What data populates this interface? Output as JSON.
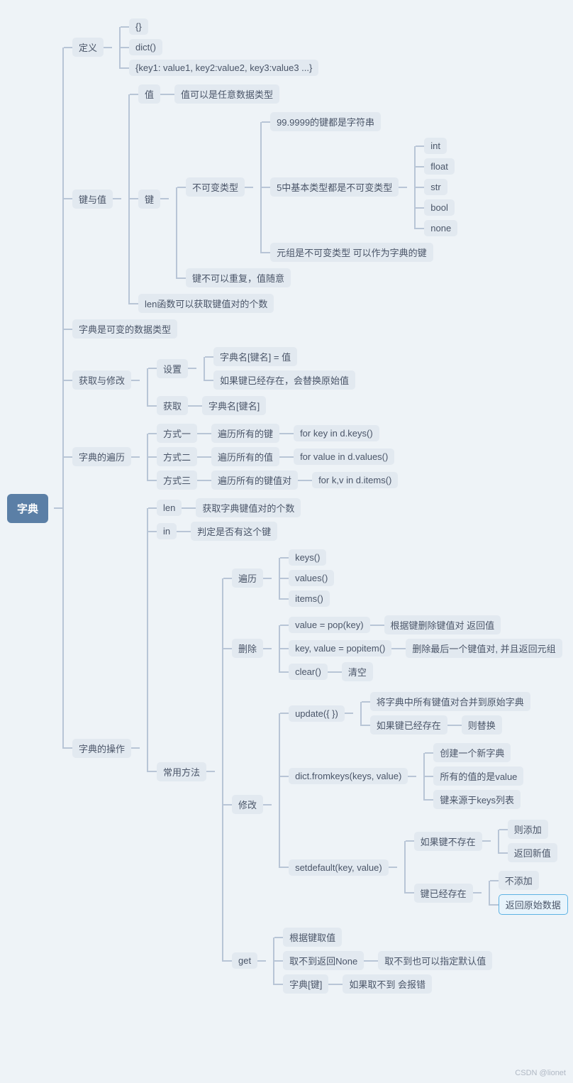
{
  "watermark": "CSDN @lionet",
  "root": "字典",
  "def": {
    "label": "定义",
    "c": [
      "{}",
      "dict()",
      "{key1: value1, key2:value2, key3:value3 ...}"
    ]
  },
  "kv": {
    "label": "键与值",
    "value": {
      "label": "值",
      "desc": "值可以是任意数据类型"
    },
    "key": {
      "label": "键",
      "immutable": {
        "label": "不可变类型",
        "most": "99.9999的键都是字符串",
        "basic": {
          "label": "5中基本类型都是不可变类型",
          "types": [
            "int",
            "float",
            "str",
            "bool",
            "none"
          ]
        },
        "tuple": "元组是不可变类型 可以作为字典的键"
      },
      "norepeat": "键不可以重复，值随意"
    },
    "len": "len函数可以获取键值对的个数"
  },
  "mutable": "字典是可变的数据类型",
  "getset": {
    "label": "获取与修改",
    "set": {
      "label": "设置",
      "c": [
        "字典名[键名] = 值",
        "如果键已经存在，会替换原始值"
      ]
    },
    "get": {
      "label": "获取",
      "c": "字典名[键名]"
    }
  },
  "iter": {
    "label": "字典的遍历",
    "ways": [
      {
        "w": "方式一",
        "d": "遍历所有的键",
        "code": "for key in d.keys()"
      },
      {
        "w": "方式二",
        "d": "遍历所有的值",
        "code": "for  value in d.values()"
      },
      {
        "w": "方式三",
        "d": "遍历所有的键值对",
        "code": "for k,v in d.items()"
      }
    ]
  },
  "ops": {
    "label": "字典的操作",
    "len": {
      "label": "len",
      "desc": "获取字典键值对的个数"
    },
    "in": {
      "label": "in",
      "desc": "判定是否有这个键"
    },
    "methods": {
      "label": "常用方法",
      "iter": {
        "label": "遍历",
        "c": [
          "keys()",
          "values()",
          "items()"
        ]
      },
      "del": {
        "label": "删除",
        "pop": {
          "label": "value = pop(key)",
          "desc": "根据键删除键值对 返回值"
        },
        "popitem": {
          "label": "key, value = popitem()",
          "desc": "删除最后一个键值对, 并且返回元组"
        },
        "clear": {
          "label": "clear()",
          "desc": "清空"
        }
      },
      "mod": {
        "label": "修改",
        "update": {
          "label": "update({ })",
          "c1": "将字典中所有键值对合并到原始字典",
          "c2": "如果键已经存在",
          "c3": "则替换"
        },
        "fromkeys": {
          "label": "dict.fromkeys(keys, value)",
          "c": [
            "创建一个新字典",
            "所有的值的是value",
            "键来源于keys列表"
          ]
        },
        "setdefault": {
          "label": "setdefault(key, value)",
          "absent": {
            "label": "如果键不存在",
            "c": [
              "则添加",
              "返回新值"
            ]
          },
          "present": {
            "label": "键已经存在",
            "c1": "不添加",
            "c2": "返回原始数据"
          }
        }
      },
      "get": {
        "label": "get",
        "c1": "根据键取值",
        "c2": {
          "label": "取不到返回None",
          "desc": "取不到也可以指定默认值"
        },
        "c3": {
          "label": "字典[键]",
          "desc": "如果取不到 会报错"
        }
      }
    }
  }
}
